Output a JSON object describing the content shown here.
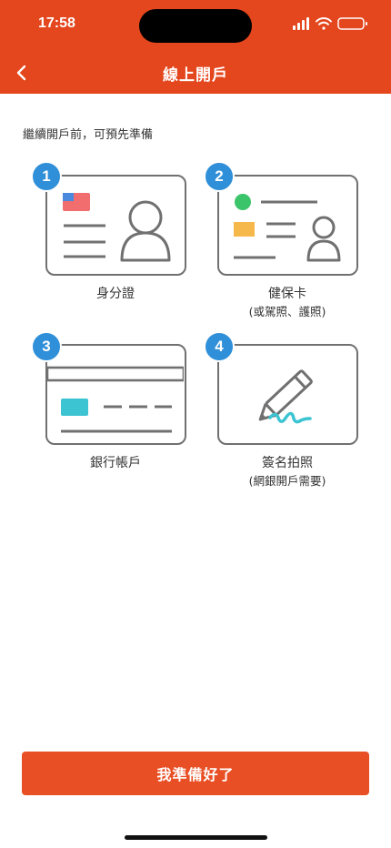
{
  "status_bar": {
    "time": "17:58"
  },
  "nav": {
    "title": "線上開戶"
  },
  "intro_text": "繼續開戶前，可預先準備",
  "steps": [
    {
      "number": "1",
      "title": "身分證",
      "subtitle": ""
    },
    {
      "number": "2",
      "title": "健保卡",
      "subtitle": "(或駕照、護照)"
    },
    {
      "number": "3",
      "title": "銀行帳戶",
      "subtitle": ""
    },
    {
      "number": "4",
      "title": "簽名拍照",
      "subtitle": "(網銀開戶需要)"
    }
  ],
  "primary_button": {
    "label": "我準備好了"
  },
  "colors": {
    "header": "#e4461d",
    "button": "#e94f24",
    "badge": "#2f8fd8",
    "card_border": "#707070",
    "flag_red": "#f26d6d",
    "flag_blue": "#4a89dc",
    "green_dot": "#3cc46a",
    "orange_block": "#f7b84b",
    "card_chip": "#3cc4d3",
    "signature": "#3cc4d3"
  },
  "icons": {
    "back": "chevron-left-icon",
    "signal": "signal-icon",
    "wifi": "wifi-icon",
    "battery": "battery-icon",
    "id_card": "id-card-icon",
    "health_card": "health-card-icon",
    "bank_card": "bank-card-icon",
    "signature": "pen-signature-icon"
  }
}
